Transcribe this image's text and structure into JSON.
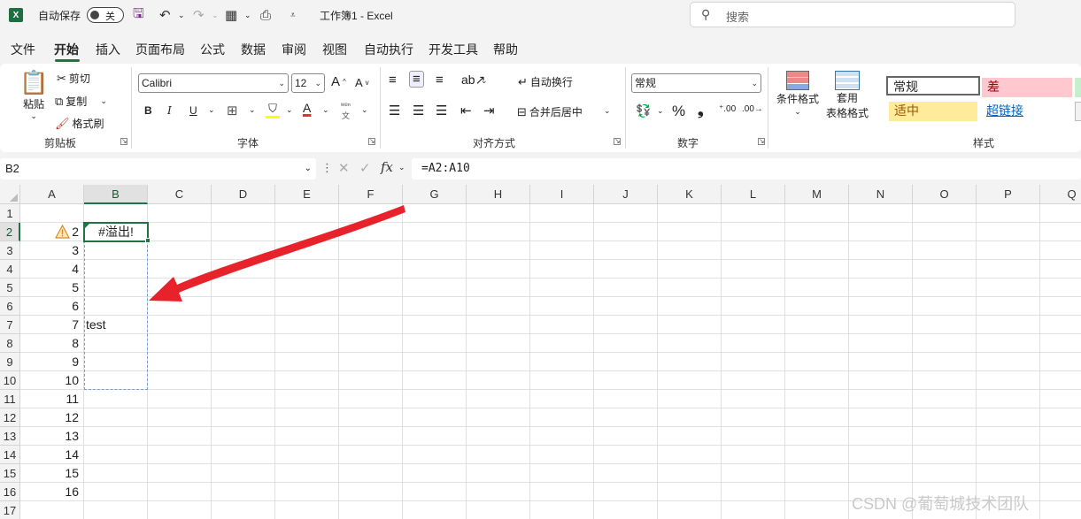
{
  "app": {
    "logo": "X",
    "title": "工作簿1  -  Excel"
  },
  "quick_access": {
    "autosave_label": "自动保存",
    "autosave_state": "关"
  },
  "search": {
    "placeholder": "搜索"
  },
  "menu": {
    "tabs": [
      "文件",
      "开始",
      "插入",
      "页面布局",
      "公式",
      "数据",
      "审阅",
      "视图",
      "自动执行",
      "开发工具",
      "帮助"
    ],
    "active": "开始"
  },
  "ribbon": {
    "clipboard": {
      "paste": "粘贴",
      "cut": "剪切",
      "copy": "复制",
      "format_painter": "格式刷",
      "label": "剪贴板"
    },
    "font": {
      "name": "Calibri",
      "size": "12",
      "bold": "B",
      "italic": "I",
      "underline": "U",
      "label": "字体",
      "font_color": "#e03030",
      "highlight_color": "#ffff00"
    },
    "alignment": {
      "wrap": "自动换行",
      "merge": "合并后居中",
      "label": "对齐方式"
    },
    "number": {
      "format": "常规",
      "percent": "%",
      "comma": "❟",
      "label": "数字"
    },
    "styles": {
      "conditional": "条件格式",
      "table_line1": "套用",
      "table_line2": "表格格式",
      "normal": "常规",
      "bad": "差",
      "neutral": "适中",
      "hyperlink": "超链接",
      "label": "样式"
    }
  },
  "formula_bar": {
    "name_box": "B2",
    "formula": "=A2:A10",
    "fx": "fx"
  },
  "sheet": {
    "columns": [
      "A",
      "B",
      "C",
      "D",
      "E",
      "F",
      "G",
      "H",
      "I",
      "J",
      "K",
      "L",
      "M",
      "N",
      "O",
      "P",
      "Q"
    ],
    "rows": [
      "1",
      "2",
      "3",
      "4",
      "5",
      "6",
      "7",
      "8",
      "9",
      "10",
      "11",
      "12",
      "13",
      "14",
      "15",
      "16",
      "17"
    ],
    "col_a_values": [
      "",
      "2",
      "3",
      "4",
      "5",
      "6",
      "7",
      "8",
      "9",
      "10",
      "11",
      "12",
      "13",
      "14",
      "15",
      "16",
      ""
    ],
    "b2": "#溢出!",
    "b7": "test",
    "selected_cell": "B2"
  },
  "watermark": "CSDN @葡萄城技术团队",
  "annotation": {
    "arrow_color": "#e8222a"
  }
}
